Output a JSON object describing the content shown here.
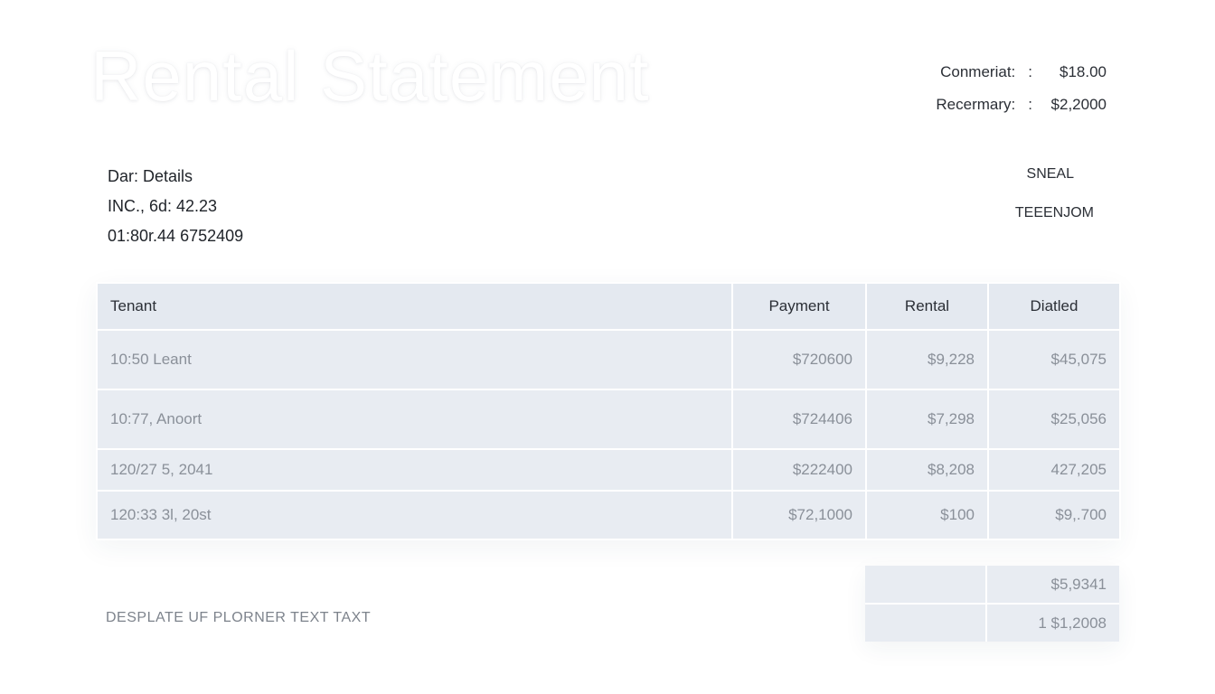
{
  "header": {
    "title": "Rental Statement"
  },
  "summary": {
    "rows": [
      {
        "label": "Conmeriat:",
        "separator": ":",
        "value": "$18.00"
      },
      {
        "label": "Recermary:",
        "separator": ":",
        "value": "$2,2000"
      }
    ]
  },
  "details": {
    "lines": [
      "Dar: Details",
      "INC., 6d: 42.23",
      "01:80r.44 6752409"
    ]
  },
  "side_note": {
    "line1": "SNEAL",
    "line2": "TEEENJOM"
  },
  "table": {
    "headers": [
      "Tenant",
      "Payment",
      "Rental",
      "Diatled"
    ],
    "rows": [
      {
        "tenant": "10:50 Leant",
        "payment": "$720600",
        "rental": "$9,228",
        "dialed": "$45,075"
      },
      {
        "tenant": "10:77, Anoort",
        "payment": "$724406",
        "rental": "$7,298",
        "dialed": "$25,056"
      },
      {
        "tenant": "120/27 5, 2041",
        "payment": "$222400",
        "rental": "$8,208",
        "dialed": "427,205"
      },
      {
        "tenant": "120:33 3l, 20st",
        "payment": "$72,1000",
        "rental": "$100",
        "dialed": "$9,.700"
      }
    ]
  },
  "totals": {
    "values": [
      "$5,9341",
      "1 $1,2008"
    ]
  },
  "footer": {
    "note": "DESPLATE UF PLORNER TEXT TAXT"
  }
}
